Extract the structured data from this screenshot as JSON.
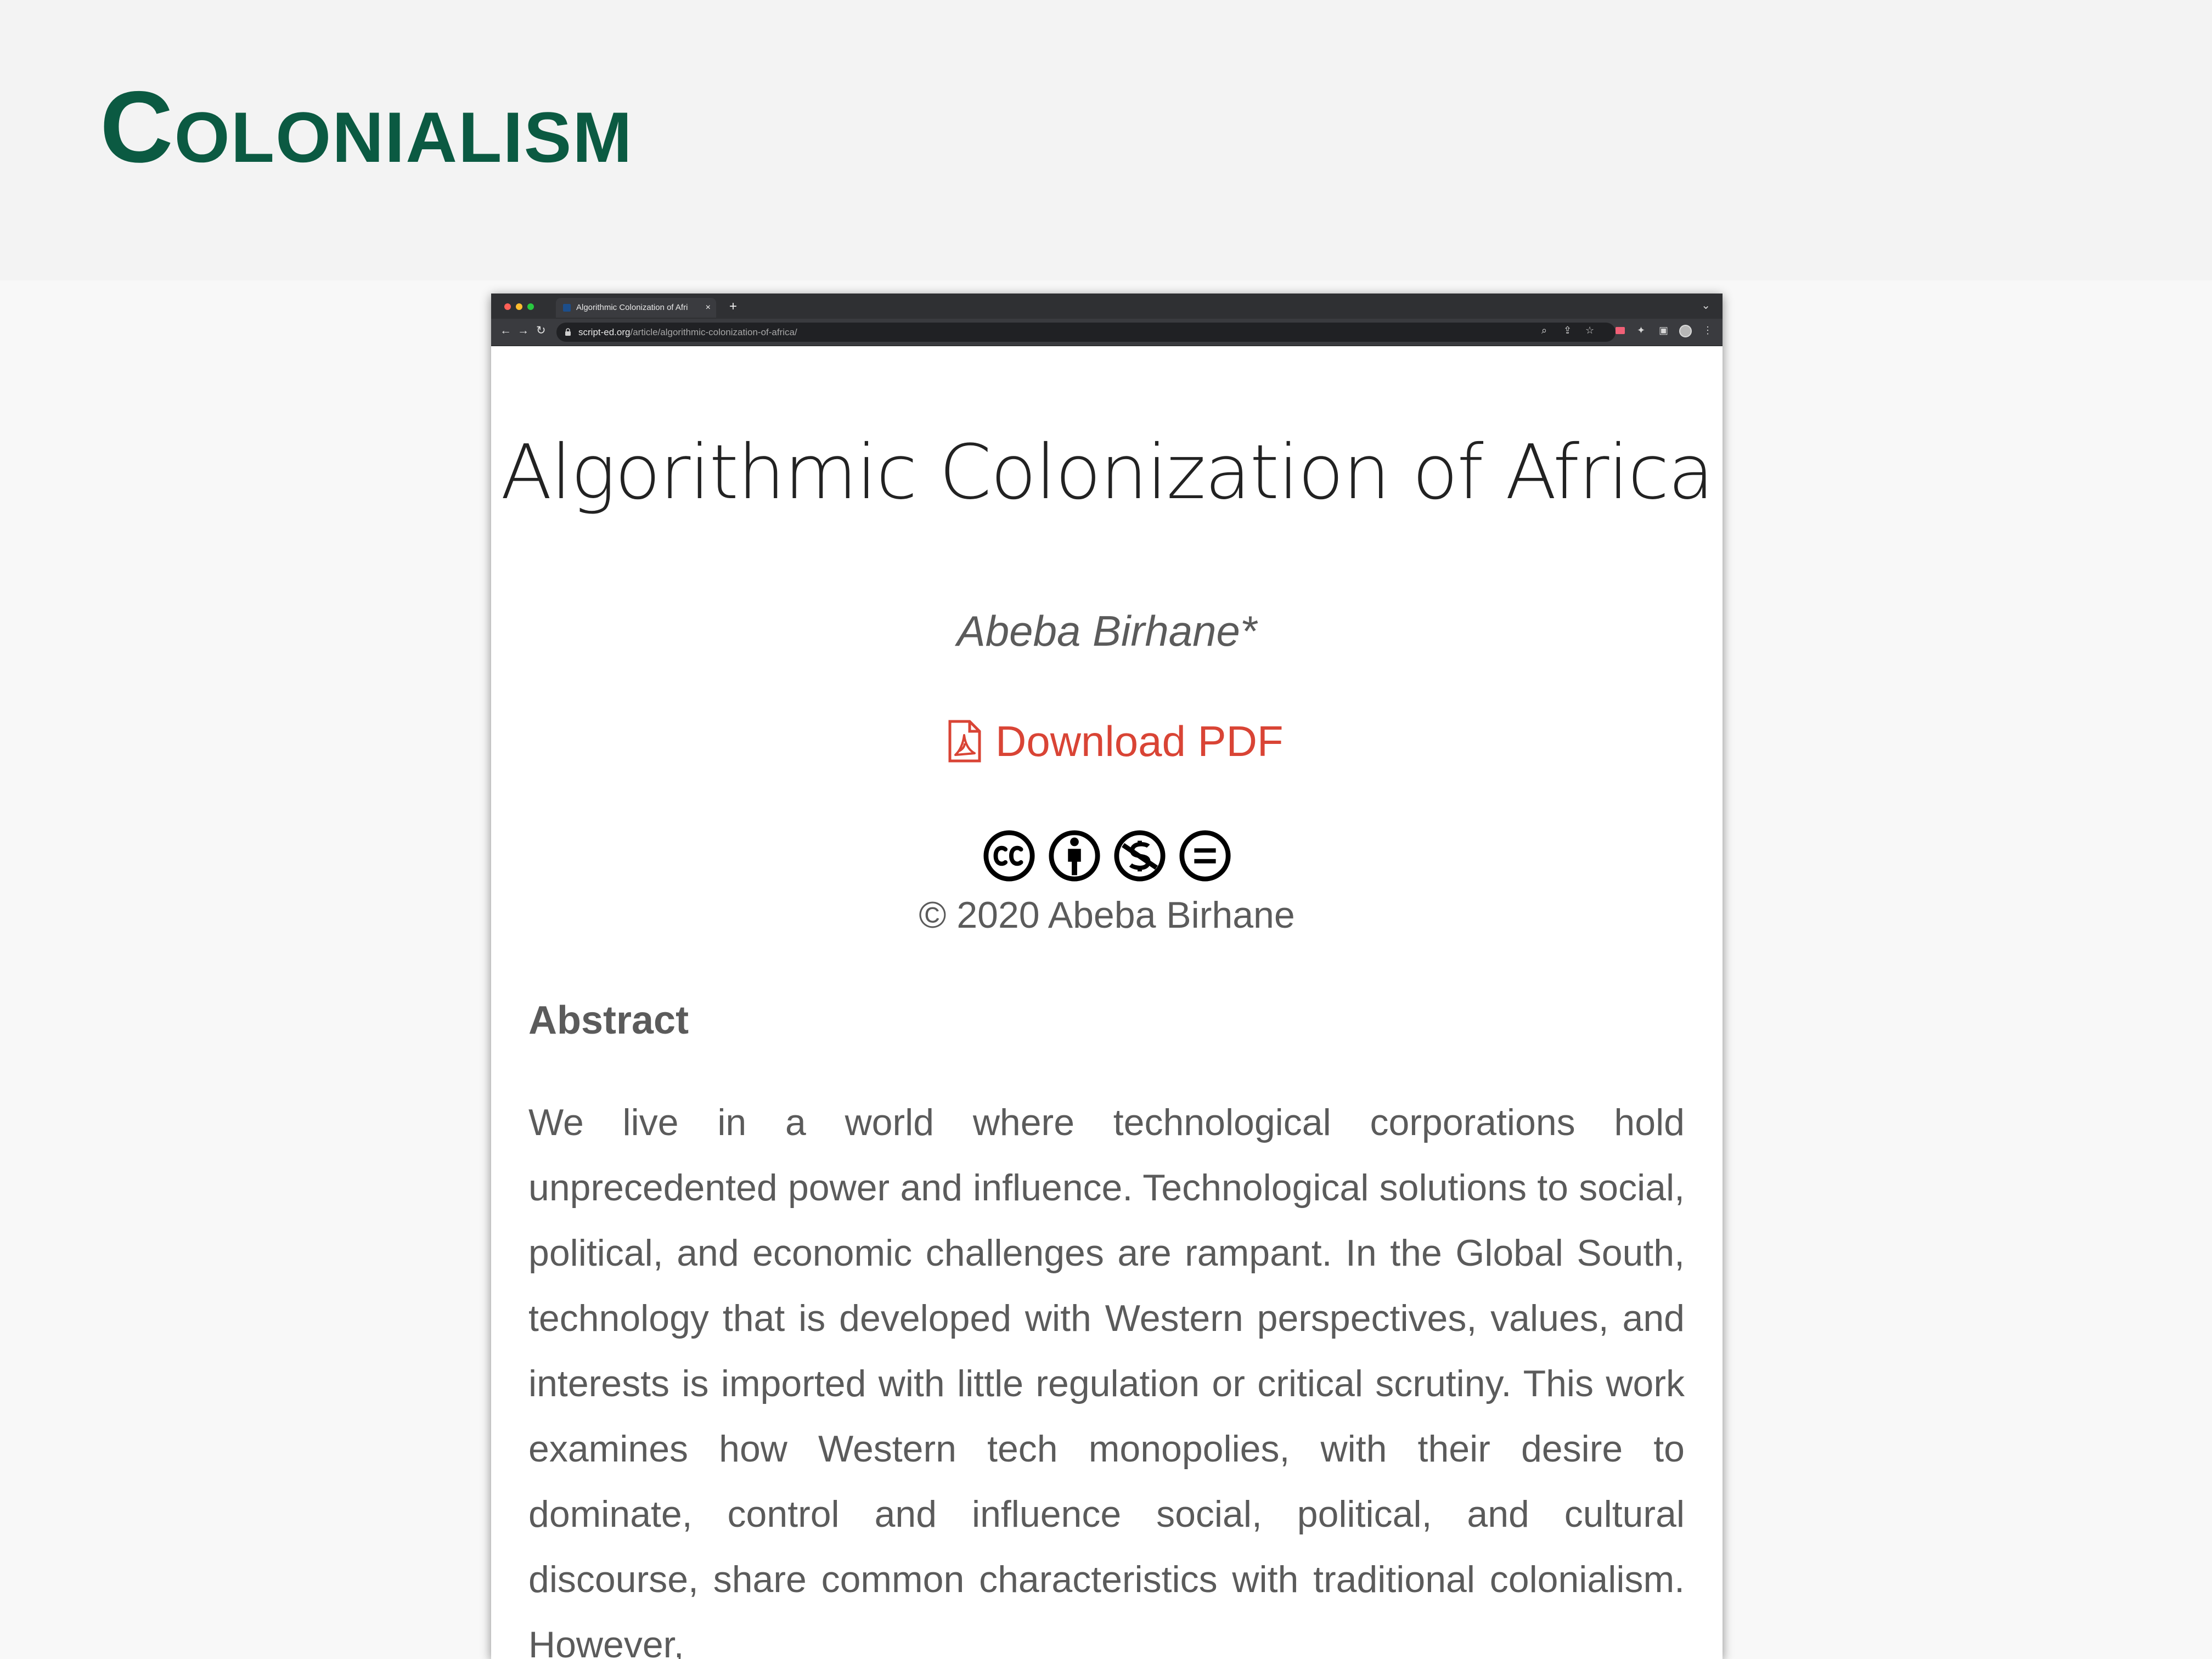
{
  "slide": {
    "title": "Colonialism"
  },
  "browser": {
    "tab": {
      "title": "Algorithmic Colonization of Afri",
      "close_icon": "×",
      "new_tab_icon": "+"
    },
    "address": {
      "domain": "script-ed.org",
      "path": "/article/algorithmic-colonization-of-africa/"
    },
    "icons": {
      "back": "←",
      "forward": "→",
      "reload": "↻",
      "zoom": "⌕",
      "share": "⇪",
      "star": "☆",
      "extension": "✦",
      "side_panel": "▣",
      "more": "⋮",
      "tab_menu": "⌄"
    }
  },
  "article": {
    "title": "Algorithmic Colonization of Africa",
    "author": "Abeba Birhane*",
    "download_label": "Download PDF",
    "license_icons": [
      "creative-commons-icon",
      "attribution-icon",
      "noncommercial-icon",
      "no-derivatives-icon"
    ],
    "copyright": "© 2020 Abeba Birhane",
    "abstract_heading": "Abstract",
    "abstract_text": "We live in a world where technological corporations hold unprecedented power and influence. Technological solutions to social, political, and economic challenges are rampant. In the Global South, technology that is developed with Western perspectives, values, and interests is imported with little regulation or critical scrutiny. This work examines how Western tech monopolies, with their desire to dominate, control and influence social, political, and cultural discourse, share common characteristics with traditional colonialism. However,"
  },
  "colors": {
    "title_green": "#0b5a42",
    "download_red": "#d94435",
    "body_gray": "#5b5b5b"
  }
}
